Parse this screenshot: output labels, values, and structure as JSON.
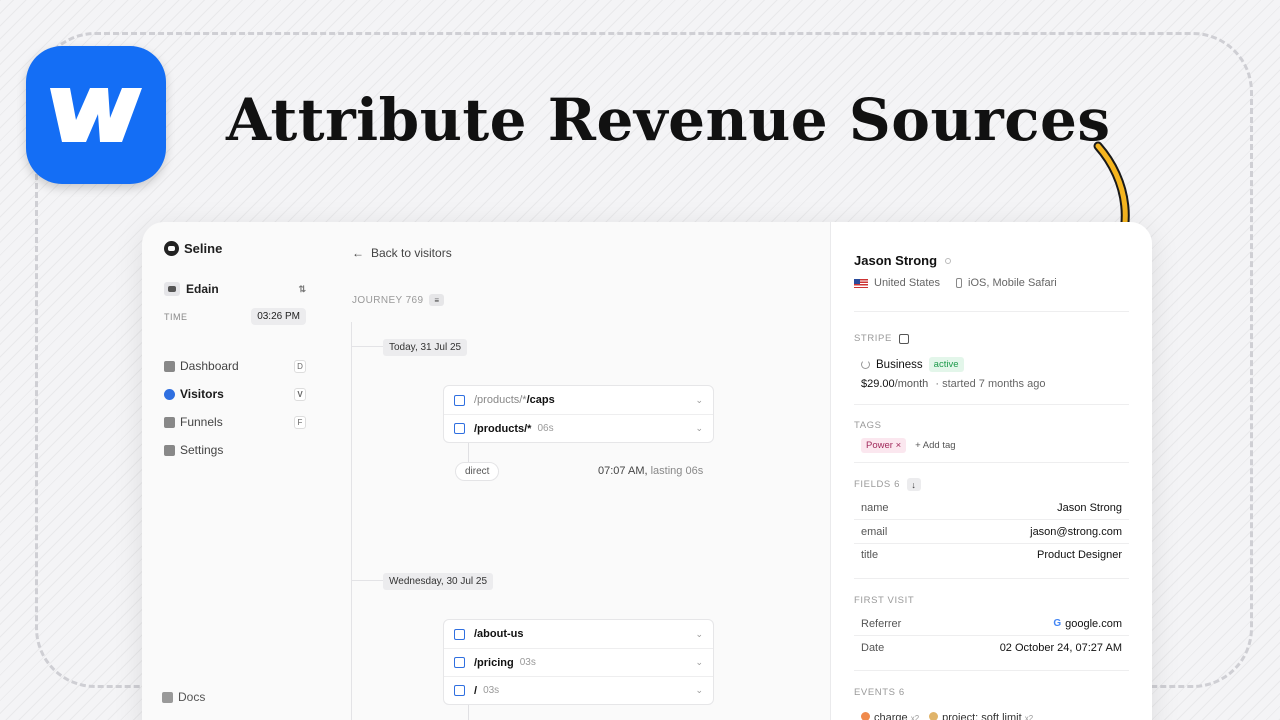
{
  "hero": {
    "title": "Attribute Revenue Sources",
    "logo": "webflow-logo",
    "arrow_color": "#f5b51f"
  },
  "sidebar": {
    "brand": "Seline",
    "workspace": "Edain",
    "time_label": "TIME",
    "time_value": "03:26 PM",
    "nav": [
      {
        "label": "Dashboard",
        "key": "D",
        "icon": "dashboard-icon"
      },
      {
        "label": "Visitors",
        "key": "V",
        "icon": "visitors-icon",
        "active": true
      },
      {
        "label": "Funnels",
        "key": "F",
        "icon": "funnels-icon"
      },
      {
        "label": "Settings",
        "key": "",
        "icon": "settings-icon"
      }
    ],
    "docs": "Docs"
  },
  "journey": {
    "back_label": "Back to visitors",
    "label": "JOURNEY 769",
    "days": [
      {
        "date": "Today, 31 Jul 25",
        "pages": [
          {
            "dim": "/products/*",
            "bold": "/caps",
            "duration": ""
          },
          {
            "dim": "",
            "bold": "/products/*",
            "duration": "06s"
          }
        ],
        "source": "direct",
        "time": "07:07 AM,",
        "lasting": "lasting 06s"
      },
      {
        "date": "Wednesday, 30 Jul 25",
        "pages": [
          {
            "dim": "",
            "bold": "/about-us",
            "duration": ""
          },
          {
            "dim": "",
            "bold": "/pricing",
            "duration": "03s"
          },
          {
            "dim": "",
            "bold": "/",
            "duration": "03s"
          }
        ]
      }
    ]
  },
  "profile": {
    "name": "Jason Strong",
    "country": "United States",
    "device": "iOS, Mobile Safari",
    "stripe_label": "STRIPE",
    "plan": "Business",
    "plan_status": "active",
    "price": "$29.00",
    "price_unit": "/month",
    "started": "started 7 months ago",
    "tags_label": "TAGS",
    "tags": [
      "Power"
    ],
    "add_tag": "Add tag",
    "fields_label": "FIELDS 6",
    "fields": [
      {
        "key": "name",
        "value": "Jason Strong"
      },
      {
        "key": "email",
        "value": "jason@strong.com"
      },
      {
        "key": "title",
        "value": "Product Designer"
      }
    ],
    "first_visit_label": "FIRST VISIT",
    "first_visit": [
      {
        "key": "Referrer",
        "value": "google.com"
      },
      {
        "key": "Date",
        "value": "02 October 24, 07:27 AM"
      }
    ],
    "events_label": "EVENTS 6",
    "events": [
      {
        "name": "charge",
        "count": "x2"
      },
      {
        "name": "project: soft limit",
        "count": "x2"
      }
    ]
  }
}
